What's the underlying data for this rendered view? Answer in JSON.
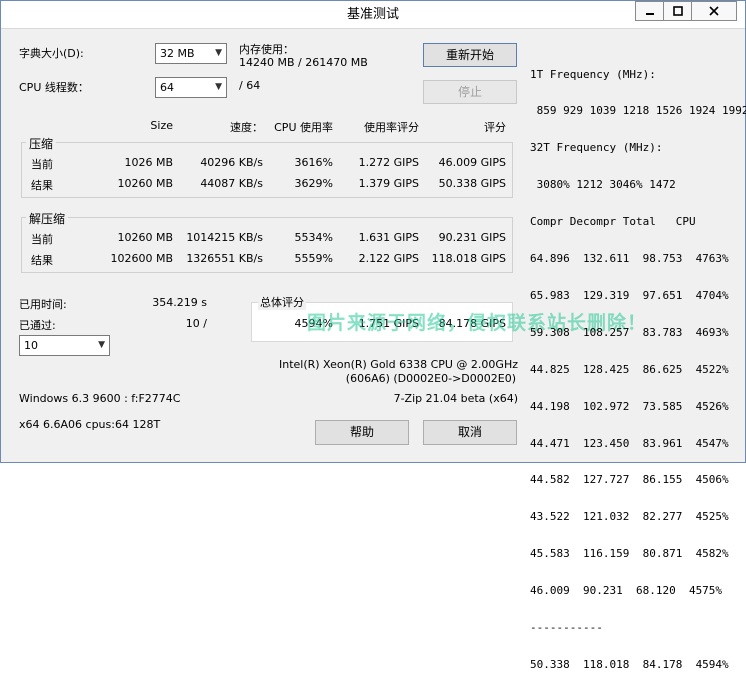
{
  "window": {
    "title": "基准测试"
  },
  "settings": {
    "dict_label": "字典大小(D):",
    "dict_value": "32 MB",
    "mem_label": "内存使用：",
    "mem_value": "14240 MB / 261470 MB",
    "threads_label": "CPU 线程数：",
    "threads_value": "64",
    "threads_total": "/ 64"
  },
  "buttons": {
    "restart": "重新开始",
    "stop": "停止",
    "help": "帮助",
    "cancel": "取消"
  },
  "table": {
    "headers": {
      "size": "Size",
      "speed": "速度：",
      "usage": "CPU 使用率",
      "rating": "使用率评分",
      "score": "评分"
    },
    "compress": {
      "label": "压缩",
      "current": {
        "label": "当前",
        "size": "1026 MB",
        "speed": "40296 KB/s",
        "usage": "3616%",
        "rating": "1.272 GIPS",
        "score": "46.009 GIPS"
      },
      "result": {
        "label": "结果",
        "size": "10260 MB",
        "speed": "44087 KB/s",
        "usage": "3629%",
        "rating": "1.379 GIPS",
        "score": "50.338 GIPS"
      }
    },
    "decompress": {
      "label": "解压缩",
      "current": {
        "label": "当前",
        "size": "10260 MB",
        "speed": "1014215 KB/s",
        "usage": "5534%",
        "rating": "1.631 GIPS",
        "score": "90.231 GIPS"
      },
      "result": {
        "label": "结果",
        "size": "102600 MB",
        "speed": "1326551 KB/s",
        "usage": "5559%",
        "rating": "2.122 GIPS",
        "score": "118.018 GIPS"
      }
    }
  },
  "stats": {
    "elapsed_label": "已用时间:",
    "elapsed_value": "354.219 s",
    "passed_label": "已通过:",
    "passed_value": "10 /",
    "passes_select": "10"
  },
  "total": {
    "label": "总体评分",
    "usage": "4594%",
    "rating": "1.751 GIPS",
    "score": "84.178 GIPS"
  },
  "sysinfo": {
    "cpu": "Intel(R) Xeon(R) Gold 6338 CPU @ 2.00GHz",
    "cpu_id": "(606A6) (D0002E0->D0002E0)",
    "os": "Windows 6.3 9600 : f:F2774C",
    "version": "7-Zip 21.04 beta (x64)",
    "arch": "x64 6.6A06 cpus:64 128T"
  },
  "freq_panel": {
    "lines": [
      "1T Frequency (MHz):",
      " 859 929 1039 1218 1526 1924 1992",
      "32T Frequency (MHz):",
      " 3080% 1212 3046% 1472",
      "Compr Decompr Total   CPU",
      "64.896  132.611  98.753  4763%",
      "65.983  129.319  97.651  4704%",
      "59.308  108.257  83.783  4693%",
      "44.825  128.425  86.625  4522%",
      "44.198  102.972  73.585  4526%",
      "44.471  123.450  83.961  4547%",
      "44.582  127.727  86.155  4506%",
      "43.522  121.032  82.277  4525%",
      "45.583  116.159  80.871  4582%",
      "46.009  90.231  68.120  4575%",
      "-----------",
      "50.338  118.018  84.178  4594%"
    ]
  },
  "watermark": "图片来源于网络，侵权联系站长删除！"
}
